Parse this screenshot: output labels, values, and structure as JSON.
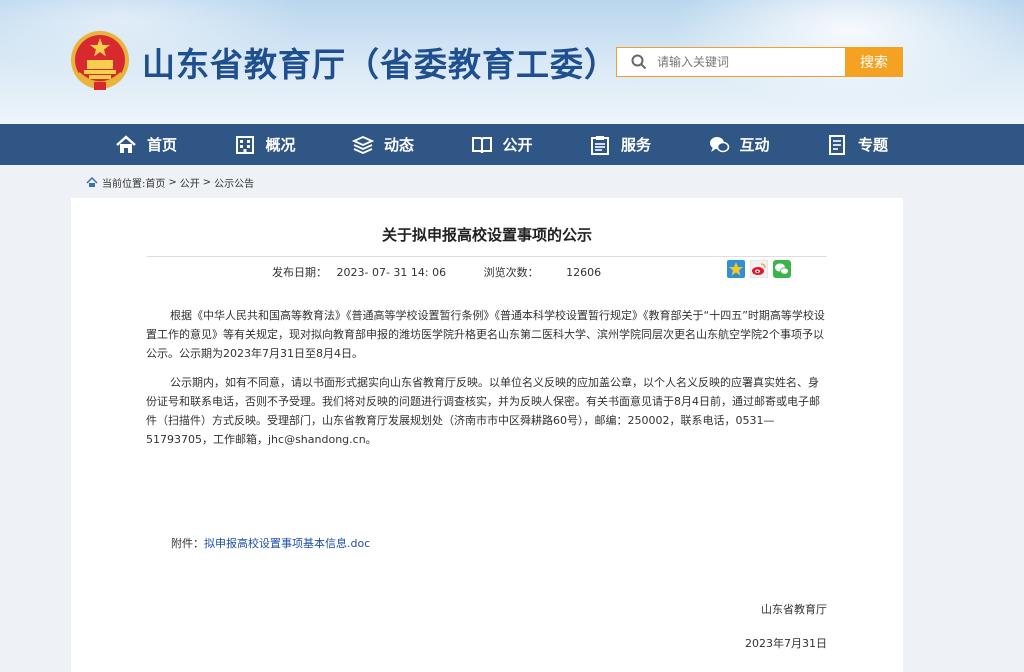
{
  "site": {
    "title": "山东省教育厅（省委教育工委）"
  },
  "search": {
    "placeholder": "请输入关键词",
    "button_label": "搜索"
  },
  "nav": {
    "items": [
      {
        "label": "首页",
        "icon": "home-icon"
      },
      {
        "label": "概况",
        "icon": "building-icon"
      },
      {
        "label": "动态",
        "icon": "layers-icon"
      },
      {
        "label": "公开",
        "icon": "book-icon"
      },
      {
        "label": "服务",
        "icon": "clipboard-icon"
      },
      {
        "label": "互动",
        "icon": "chat-icon"
      },
      {
        "label": "专题",
        "icon": "document-icon"
      }
    ]
  },
  "breadcrumb": {
    "prefix": "当前位置:",
    "home": "首页",
    "sep1": ">",
    "section": "公开",
    "sep2": ">",
    "current": "公示公告"
  },
  "article": {
    "title": "关于拟申报高校设置事项的公示",
    "publish_label": "发布日期：",
    "publish_date": "2023- 07- 31 14: 06",
    "views_label": "浏览次数：",
    "views": "12606",
    "paragraphs": [
      "根据《中华人民共和国高等教育法》《普通高等学校设置暂行条例》《普通本科学校设置暂行规定》《教育部关于“十四五”时期高等学校设置工作的意见》等有关规定，现对拟向教育部申报的潍坊医学院升格更名山东第二医科大学、滨州学院同层次更名山东航空学院2个事项予以公示。公示期为2023年7月31日至8月4日。",
      "公示期内，如有不同意，请以书面形式据实向山东省教育厅反映。以单位名义反映的应加盖公章，以个人名义反映的应署真实姓名、身份证号和联系电话，否则不予受理。我们将对反映的问题进行调查核实，并为反映人保密。有关书面意见请于8月4日前，通过邮寄或电子邮件（扫描件）方式反映。受理部门，山东省教育厅发展规划处（济南市市中区舜耕路60号），邮编：250002，联系电话，0531—51793705，工作邮箱，jhc@shandong.cn。"
    ],
    "attachment_label": "附件：",
    "attachment_link": "拟申报高校设置事项基本信息.doc",
    "sign_org": "山东省教育厅",
    "sign_date": "2023年7月31日"
  },
  "colors": {
    "nav_bg": "#2f5684",
    "title_blue": "#1f4f8e",
    "search_orange": "#f5a122",
    "link_blue": "#1d4fa8"
  }
}
